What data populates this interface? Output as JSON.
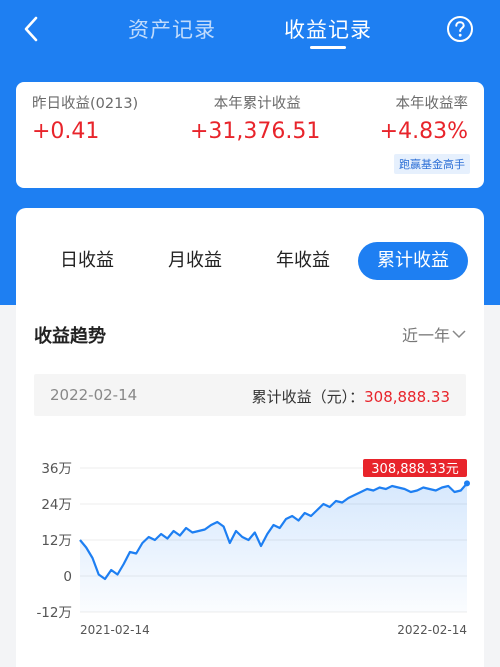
{
  "nav": {
    "back_icon": "chevron-left-icon",
    "tabs": [
      {
        "label": "资产记录",
        "active": false
      },
      {
        "label": "收益记录",
        "active": true
      }
    ],
    "help_icon": "question-circle-icon"
  },
  "summary": {
    "yesterday": {
      "label": "昨日收益(0213)",
      "value": "+0.41"
    },
    "ytd_total": {
      "label": "本年累计收益",
      "value": "+31,376.51"
    },
    "ytd_rate": {
      "label": "本年收益率",
      "value": "+4.83%"
    },
    "badge": "跑赢基金高手"
  },
  "segments": [
    {
      "label": "日收益",
      "active": false
    },
    {
      "label": "月收益",
      "active": false
    },
    {
      "label": "年收益",
      "active": false
    },
    {
      "label": "累计收益",
      "active": true
    }
  ],
  "trend": {
    "title": "收益趋势",
    "range": "近一年",
    "range_icon": "chevron-down-icon"
  },
  "info": {
    "date": "2022-02-14",
    "label": "累计收益（元）：",
    "value": "308,888.33"
  },
  "colors": {
    "brand_blue": "#1e7ff2",
    "gain_red": "#e8242b"
  },
  "chart_data": {
    "type": "area",
    "y_tick_labels": [
      "36万",
      "24万",
      "12万",
      "0",
      "-12万"
    ],
    "y_ticks": [
      360000,
      240000,
      120000,
      0,
      -120000
    ],
    "ylim": [
      -120000,
      360000
    ],
    "x_tick_labels": [
      "2021-02-14",
      "2022-02-14"
    ],
    "highlight_label": "308,888.33元",
    "series": [
      {
        "values": [
          120000,
          95000,
          60000,
          5000,
          -10000,
          20000,
          5000,
          40000,
          80000,
          75000,
          110000,
          130000,
          120000,
          140000,
          125000,
          150000,
          135000,
          160000,
          145000,
          150000,
          155000,
          170000,
          180000,
          165000,
          110000,
          150000,
          130000,
          120000,
          145000,
          100000,
          140000,
          170000,
          160000,
          190000,
          200000,
          185000,
          210000,
          200000,
          220000,
          240000,
          230000,
          250000,
          245000,
          260000,
          270000,
          280000,
          290000,
          285000,
          295000,
          290000,
          300000,
          295000,
          290000,
          280000,
          285000,
          295000,
          290000,
          285000,
          295000,
          300000,
          280000,
          285000,
          308888
        ]
      }
    ]
  }
}
